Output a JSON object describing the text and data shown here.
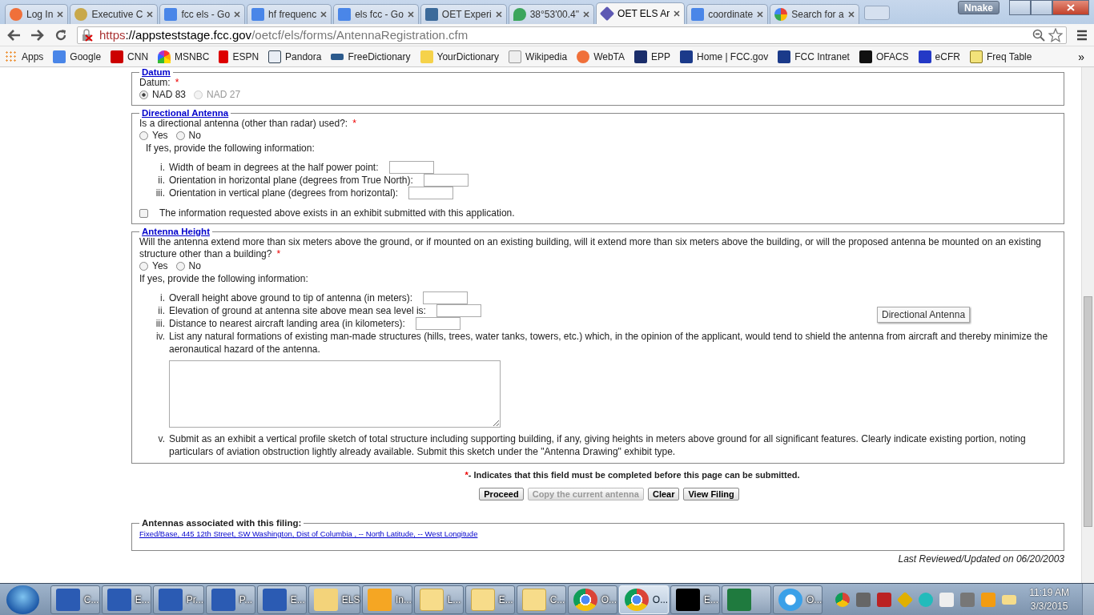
{
  "browser": {
    "tabs": [
      {
        "title": "Log In",
        "selected": false
      },
      {
        "title": "Executive C",
        "selected": false
      },
      {
        "title": "fcc els - Go",
        "selected": false
      },
      {
        "title": "hf frequenc",
        "selected": false
      },
      {
        "title": "els fcc - Go",
        "selected": false
      },
      {
        "title": "OET Experi",
        "selected": false
      },
      {
        "title": "38°53'00.4\"",
        "selected": false
      },
      {
        "title": "OET ELS Ar",
        "selected": true
      },
      {
        "title": "coordinate",
        "selected": false
      },
      {
        "title": "Search for a",
        "selected": false
      }
    ],
    "user": "Nnake",
    "address": {
      "scheme": "https",
      "host": "://appsteststage.fcc.gov",
      "path": "/oetcf/els/forms/AntennaRegistration.cfm"
    },
    "bookmarks": [
      "Apps",
      "Google",
      "CNN",
      "MSNBC",
      "ESPN",
      "Pandora",
      "FreeDictionary",
      "YourDictionary",
      "Wikipedia",
      "WebTA",
      "EPP",
      "Home | FCC.gov",
      "FCC Intranet",
      "OFACS",
      "eCFR",
      "Freq Table"
    ],
    "bookmarks_more": "»"
  },
  "form": {
    "datum": {
      "legend": "Datum",
      "label": "Datum:",
      "required": "*",
      "options": [
        {
          "label": "NAD 83",
          "selected": true,
          "disabled": false
        },
        {
          "label": "NAD 27",
          "selected": false,
          "disabled": true
        }
      ]
    },
    "directional": {
      "legend": "Directional Antenna",
      "question": "Is a directional antenna (other than radar) used?:",
      "required": "*",
      "options": [
        {
          "label": "Yes",
          "selected": false
        },
        {
          "label": "No",
          "selected": false
        }
      ],
      "intro": "If yes, provide the following information:",
      "items": [
        {
          "num": "i.",
          "label": "Width of beam in degrees at the half power point:",
          "kind": "field"
        },
        {
          "num": "ii.",
          "label": "Orientation in horizontal plane (degrees from True North):",
          "kind": "field"
        },
        {
          "num": "iii.",
          "label": "Orientation in vertical plane (degrees from horizontal):",
          "kind": "field"
        }
      ],
      "exhibit": {
        "label": "The information requested above exists in an exhibit submitted with this application.",
        "checked": false
      }
    },
    "height": {
      "legend": "Antenna Height",
      "question": "Will the antenna extend more than six meters above the ground, or if mounted on an existing building, will it extend more than six meters above the building, or will the proposed antenna be mounted on an existing structure other than a building?",
      "required": "*",
      "options": [
        {
          "label": "Yes",
          "selected": false
        },
        {
          "label": "No",
          "selected": false
        }
      ],
      "intro": "If yes, provide the following information:",
      "items": [
        {
          "num": "i.",
          "label": "Overall height above ground to tip of antenna (in meters):",
          "kind": "field"
        },
        {
          "num": "ii.",
          "label": "Elevation of ground at antenna site above mean sea level is:",
          "kind": "field"
        },
        {
          "num": "iii.",
          "label": "Distance to nearest aircraft landing area (in kilometers):",
          "kind": "field"
        },
        {
          "num": "iv.",
          "label": "List any natural formations of existing man-made structures (hills, trees, water tanks, towers, etc.) which, in the opinion of the applicant, would tend to shield the antenna from aircraft and thereby minimize the aeronautical hazard of the antenna.",
          "kind": "textarea"
        },
        {
          "num": "v.",
          "label": "Submit as an exhibit a vertical profile sketch of total structure including supporting building, if any, giving heights in meters above ground for all significant features. Clearly indicate existing portion, noting particulars of aviation obstruction lightly already available. Submit this sketch under the \"Antenna Drawing\" exhibit type.",
          "kind": "text"
        }
      ]
    },
    "note": {
      "mark": "*",
      "text": "- Indicates that this field must be completed before this page can be submitted."
    },
    "buttons": [
      {
        "label": "Proceed",
        "disabled": false
      },
      {
        "label": "Copy the current antenna",
        "disabled": true
      },
      {
        "label": "Clear",
        "disabled": false
      },
      {
        "label": "View Filing",
        "disabled": false
      }
    ],
    "antennas": {
      "legend": "Antennas associated with this filing:",
      "links": [
        "Fixed/Base, 445 12th Street, SW Washington, Dist of Columbia , -- North Latitude, -- West Longitude"
      ]
    },
    "footer": "Last Reviewed/Updated on 06/20/2003",
    "tooltip": "Directional Antenna"
  },
  "taskbar": {
    "items": [
      {
        "label": "C...",
        "selected": false
      },
      {
        "label": "E...",
        "selected": false
      },
      {
        "label": "Pr...",
        "selected": false
      },
      {
        "label": "P...",
        "selected": false
      },
      {
        "label": "E...",
        "selected": false
      },
      {
        "label": "ELS",
        "selected": false
      },
      {
        "label": "In...",
        "selected": false
      },
      {
        "label": "L...",
        "selected": false
      },
      {
        "label": "E...",
        "selected": false
      },
      {
        "label": "C...",
        "selected": false
      },
      {
        "label": "O...",
        "selected": false
      },
      {
        "label": "O...",
        "selected": true
      },
      {
        "label": "E...",
        "selected": false
      },
      {
        "selected": false
      },
      {
        "label": "O...",
        "selected": false
      }
    ],
    "time": "11:19 AM",
    "date": "3/3/2015"
  }
}
